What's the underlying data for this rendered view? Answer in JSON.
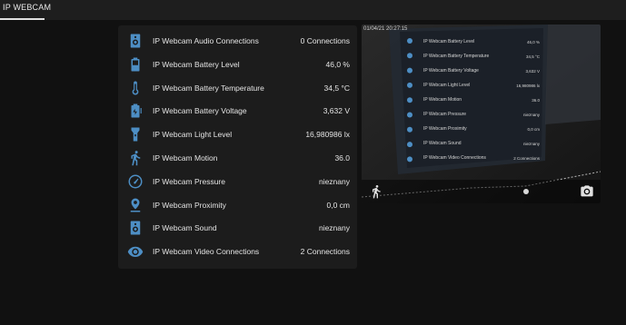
{
  "header": {
    "tab_label": "IP WEBCAM"
  },
  "colors": {
    "icon_blue": "#4d8ec4",
    "background": "#111111",
    "card": "#1c1c1c",
    "text": "#e4e4e4"
  },
  "sensors": [
    {
      "icon": "speaker-icon",
      "name": "IP Webcam Audio Connections",
      "value": "0 Connections"
    },
    {
      "icon": "battery-icon",
      "name": "IP Webcam Battery Level",
      "value": "46,0 %"
    },
    {
      "icon": "thermometer-icon",
      "name": "IP Webcam Battery Temperature",
      "value": "34,5 °C"
    },
    {
      "icon": "battery-charging-icon",
      "name": "IP Webcam Battery Voltage",
      "value": "3,632 V"
    },
    {
      "icon": "flashlight-icon",
      "name": "IP Webcam Light Level",
      "value": "16,980986 lx"
    },
    {
      "icon": "run-icon",
      "name": "IP Webcam Motion",
      "value": "36.0"
    },
    {
      "icon": "gauge-icon",
      "name": "IP Webcam Pressure",
      "value": "nieznany"
    },
    {
      "icon": "map-marker-icon",
      "name": "IP Webcam Proximity",
      "value": "0,0 cm"
    },
    {
      "icon": "speaker-icon",
      "name": "IP Webcam Sound",
      "value": "nieznany"
    },
    {
      "icon": "eye-icon",
      "name": "IP Webcam Video Connections",
      "value": "2 Connections"
    }
  ],
  "camera_feed": {
    "timestamp": "01/04/21 20:27:15",
    "rows": [
      {
        "name": "IP Webcam Battery Level",
        "value": "46,0 %"
      },
      {
        "name": "IP Webcam Battery Temperature",
        "value": "34,5 °C"
      },
      {
        "name": "IP Webcam Battery Voltage",
        "value": "3,632 V"
      },
      {
        "name": "IP Webcam Light Level",
        "value": "16,980986 lx"
      },
      {
        "name": "IP Webcam Motion",
        "value": "36.0"
      },
      {
        "name": "IP Webcam Pressure",
        "value": "nieznany"
      },
      {
        "name": "IP Webcam Proximity",
        "value": "0,0 cm"
      },
      {
        "name": "IP Webcam Sound",
        "value": "nieznany"
      },
      {
        "name": "IP Webcam Video Connections",
        "value": "2 Connections"
      }
    ]
  }
}
